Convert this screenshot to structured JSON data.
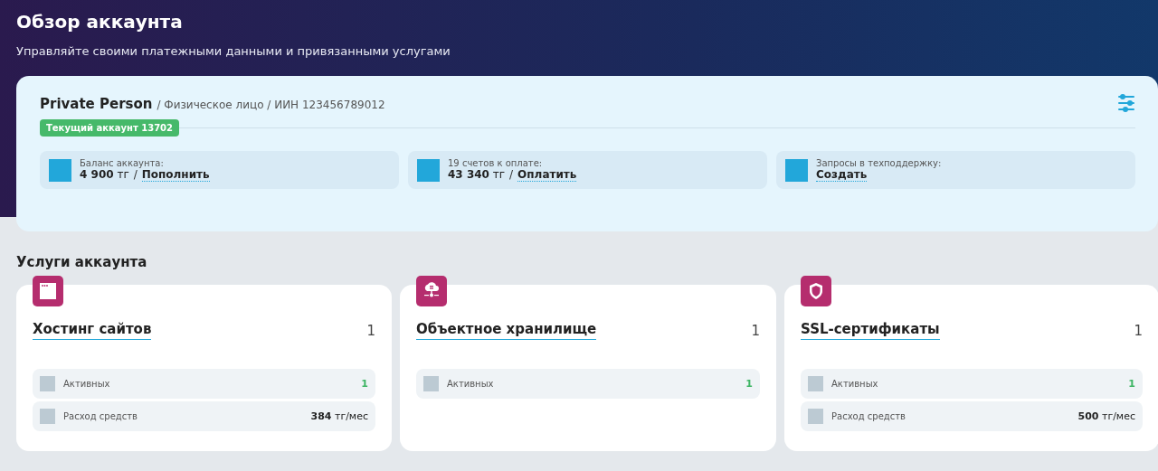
{
  "header": {
    "title": "Обзор аккаунта",
    "subtitle": "Управляйте своими платежными данными и привязанными услугами"
  },
  "account": {
    "name": "Private Person",
    "details": "/ Физическое лицо / ИИН 123456789012",
    "badge": "Текущий аккаунт 13702",
    "stats": [
      {
        "label": "Баланс аккаунта:",
        "amount": "**4 900** тг",
        "separator": "/",
        "link": "Пополнить"
      },
      {
        "label": "19 счетов к оплате:",
        "amount": "**43 340** тг",
        "separator": "/",
        "link": "Оплатить"
      },
      {
        "label": "Запросы в техподдержку:",
        "link": "Создать"
      }
    ]
  },
  "services": {
    "title": "Услуги аккаунта",
    "cards": [
      {
        "kind": "window",
        "title": "Хостинг сайтов",
        "count": "1",
        "metrics": [
          {
            "kind": "count",
            "label": "Активных",
            "value": "1"
          },
          {
            "kind": "cost",
            "label": "Расход средств",
            "value": "**384** тг/мес"
          }
        ]
      },
      {
        "kind": "cloud",
        "title": "Объектное хранилище",
        "count": "1",
        "metrics": [
          {
            "kind": "count",
            "label": "Активных",
            "value": "1"
          }
        ]
      },
      {
        "kind": "shield",
        "title": "SSL-сертификаты",
        "count": "1",
        "metrics": [
          {
            "kind": "count",
            "label": "Активных",
            "value": "1"
          },
          {
            "kind": "cost",
            "label": "Расход средств",
            "value": "**500** тг/мес"
          }
        ]
      }
    ]
  }
}
